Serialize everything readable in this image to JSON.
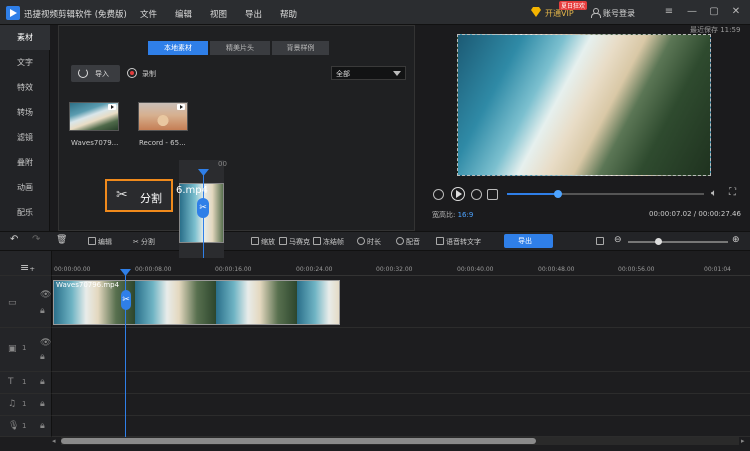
{
  "titlebar": {
    "app_title": "迅捷视频剪辑软件 (免费版)",
    "menu": [
      "文件",
      "编辑",
      "视图",
      "导出",
      "帮助"
    ],
    "vip_label": "开通VIP",
    "vip_badge": "夏日狂欢",
    "account": "账号登录",
    "window_buttons": [
      "menu-icon",
      "minimize-icon",
      "maximize-icon",
      "close-icon"
    ]
  },
  "sidebar": {
    "items": [
      "素材",
      "文字",
      "特效",
      "转场",
      "滤镜",
      "叠附",
      "动画",
      "配乐"
    ],
    "active_index": 0
  },
  "media": {
    "tabs": [
      "本地素材",
      "精美片头",
      "背景样例"
    ],
    "active_tab": 0,
    "import_label": "导入",
    "record_label": "录制",
    "filter_value": "全部",
    "items": [
      {
        "name": "Waves7079...",
        "kind": "video"
      },
      {
        "name": "Record - 65...",
        "kind": "video"
      }
    ]
  },
  "preview": {
    "saved_label": "最近保存 11:59",
    "aspect_label": "宽高比:",
    "aspect_value": "16:9",
    "timecode": "00:00:07.02 / 00:00:27.46",
    "progress_fraction": 0.26
  },
  "toolbar": {
    "edit": "编辑",
    "split": "分割",
    "zoom": "缩放",
    "mosaic": "马赛克",
    "freeze": "冻结帧",
    "duration": "时长",
    "dub": "配音",
    "speech_to_text": "语音转文字",
    "export": "导出",
    "zoom_level": 0.3
  },
  "timeline": {
    "ruler": [
      "00:00:00.00",
      "00:00:08.00",
      "00:00:16.00",
      "00:00:24.00",
      "00:00:32.00",
      "00:00:40.00",
      "00:00:48.00",
      "00:00:56.00",
      "00:01:04"
    ],
    "clip_name": "Waves70796.mp4",
    "track_numbers": [
      "1",
      "1",
      "1",
      "1"
    ]
  },
  "drag_overlay": {
    "split_label": "分割",
    "clip_label": "6.mp4",
    "tick_label": "00"
  }
}
